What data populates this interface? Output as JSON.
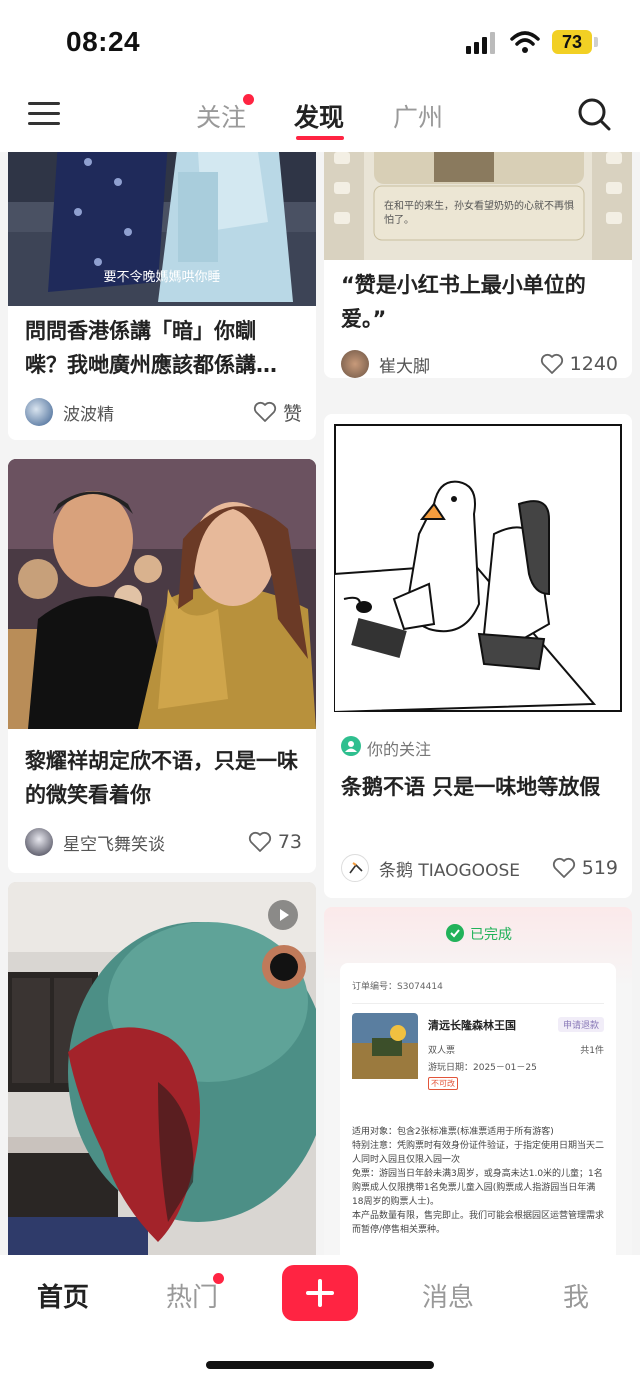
{
  "status": {
    "time": "08:24",
    "battery": "73"
  },
  "header": {
    "tabs": [
      {
        "label": "关注"
      },
      {
        "label": "发现"
      },
      {
        "label": "广州"
      }
    ]
  },
  "feed": {
    "left": [
      {
        "subtitle": "要不令晚媽媽哄你睡",
        "title": "問問香港係講「暗」你瞓 喍？我哋廣州應該都係講…",
        "author": "波波精",
        "likes": "赞"
      },
      {
        "title": "黎耀祥胡定欣不语，只是一味的微笑看着你",
        "author": "星空飞舞笑谈",
        "likes": "73"
      },
      {
        "image": "parrot-video"
      }
    ],
    "right": [
      {
        "caption": "在和平的来生，孙女看望奶奶的心就不再惧怕了。",
        "title": "“赞是小红书上最小单位的爱。”",
        "author": "崔大脚",
        "likes": "1240"
      },
      {
        "follow_tag": "你的关注",
        "title": "条鹅不语 只是一味地等放假",
        "author": "条鹅 TIAOGOOSE",
        "likes": "519"
      },
      {
        "status": "已完成",
        "order_no": "订单编号：S3074414",
        "product": "清远长隆森林王国",
        "refund": "申请退款",
        "ticket": "双人票",
        "qty": "共1件",
        "date": "游玩日期：2025－01－25",
        "tag": "不可改",
        "notes": [
          "适用对象：包含2张标准票(标准票适用于所有游客)",
          "特别注意：凭购票时有效身份证件验证，于指定使用日期当天二人同时入园且仅限入园一次",
          "免票：游园当日年龄未满3周岁，或身高未达1.0米的儿童；1名购票成人仅限携带1名免票儿童入园(购票成人指游园当日年满18周岁的购票人士)。",
          "本产品数量有限，售完即止。我们可能会根据园区运营管理需求而暂停/停售相关票种。"
        ]
      }
    ]
  },
  "bottom_nav": {
    "items": [
      {
        "label": "首页"
      },
      {
        "label": "热门"
      },
      {
        "label": "消息"
      },
      {
        "label": "我"
      }
    ]
  },
  "colors": {
    "accent": "#ff2442",
    "follow_green": "#2fbf8f"
  }
}
